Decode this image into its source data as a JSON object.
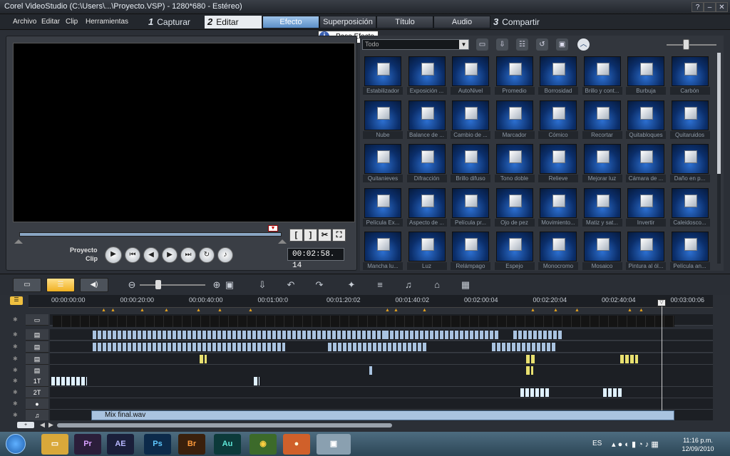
{
  "window": {
    "title": "Corel VideoStudio (C:\\Users\\...\\Proyecto.VSP) - 1280*680 - Estéreo)",
    "help_label": "?",
    "minimize_label": "–",
    "maximize_label": "□",
    "close_label": "✕"
  },
  "menu": [
    "Archivo",
    "Editar",
    "Clip",
    "Herramientas"
  ],
  "steps": [
    {
      "num": "1",
      "label": "Capturar"
    },
    {
      "num": "2",
      "label": "Editar"
    },
    {
      "num": "3",
      "label": "Compartir"
    }
  ],
  "panel_tabs": [
    "Efecto",
    "Superposición",
    "Título",
    "Audio"
  ],
  "tooltip": {
    "text": "Paso Efecto",
    "icon": "info-icon"
  },
  "player": {
    "mode_project": "Proyecto",
    "mode_clip": "Clip",
    "timecode": "00:02:58. 14",
    "mark_in": "[",
    "mark_out": "]",
    "icons": [
      "play-icon",
      "home-icon",
      "prev-frame-icon",
      "next-frame-icon",
      "end-icon",
      "repeat-icon",
      "volume-icon",
      "scissors-icon",
      "enlarge-icon"
    ]
  },
  "library": {
    "dropdown": "Todo",
    "effects": [
      "Estabilizador",
      "Exposición ...",
      "AutoNivel",
      "Promedio",
      "Borrosidad",
      "Brillo y cont...",
      "Burbuja",
      "Carbón",
      "Nube",
      "Balance de ...",
      "Cambio de ...",
      "Marcador",
      "Cómico",
      "Recortar",
      "Quitabloques",
      "Quitaruidos",
      "Quitanieves",
      "Difracción",
      "Brillo difuso",
      "Tono doble",
      "Relieve",
      "Mejorar luz",
      "Cámara de ...",
      "Daño en p...",
      "Película Ex...",
      "Aspecto de ...",
      "Película pr...",
      "Ojo de pez",
      "Movimiento...",
      "Matiz y sat...",
      "Invertir",
      "Caleidosco...",
      "Mancha lu...",
      "Luz",
      "Relámpago",
      "Espejo",
      "Monocromo",
      "Mosaico",
      "Pintura al ól...",
      "Película an..."
    ]
  },
  "timeline": {
    "ruler": [
      "00:00:00:00",
      "00:00:20:00",
      "00:00:40:00",
      "00:01:00:0",
      "00:01:20:02",
      "00:01:40:02",
      "00:02:00:04",
      "00:02:20:04",
      "00:02:40:04",
      "00:03:00:06"
    ],
    "tracks": [
      "video",
      "overlay-1",
      "overlay-2",
      "overlay-3",
      "overlay-4",
      "1T",
      "2T",
      "voice",
      "music"
    ],
    "audio_clip": "Mix final.wav"
  },
  "taskbar": {
    "apps": [
      "Pr",
      "AE",
      "Ps",
      "Br",
      "Au"
    ],
    "lang": "ES",
    "time": "11:16 p.m.",
    "date": "12/09/2010"
  },
  "colors": {
    "accent": "#5b8ec6",
    "selected": "#f0b022",
    "preview_bg": "#000000"
  }
}
